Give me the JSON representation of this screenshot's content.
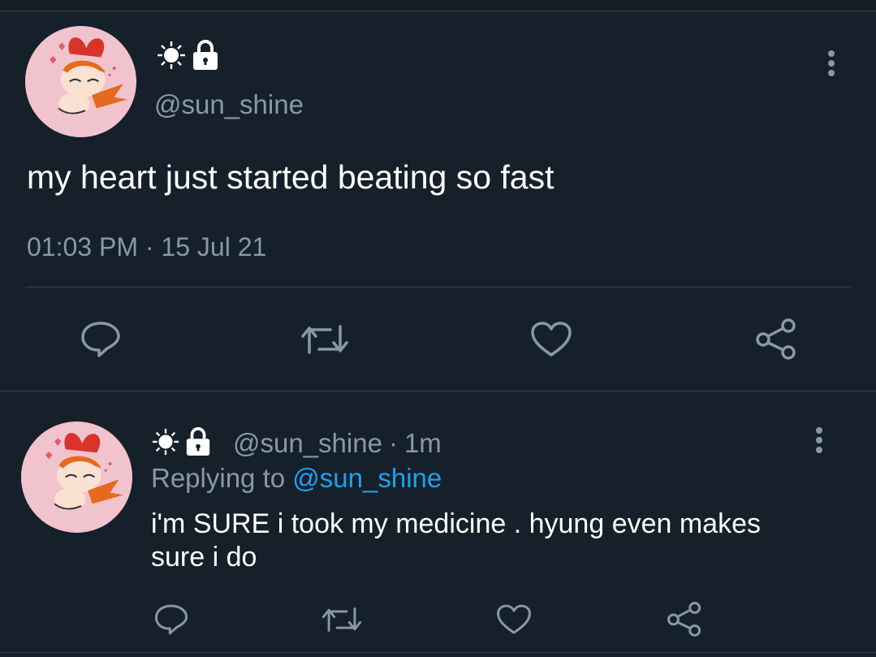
{
  "main_tweet": {
    "handle": "@sun_shine",
    "text": "my heart just started beating so fast",
    "time": "01:03 PM",
    "date_sep": "·",
    "date": "15 Jul 21"
  },
  "reply_tweet": {
    "handle": "@sun_shine",
    "sep": "·",
    "age": "1m",
    "replying_prefix": "Replying to",
    "replying_to": "@sun_shine",
    "text": "i'm SURE i took my medicine . hyung even makes sure i do"
  },
  "icons": {
    "avatar": "powerpuff-avatar-icon",
    "sun": "sun-icon",
    "lock": "lock-icon",
    "more": "more-vertical-icon",
    "reply": "reply-icon",
    "retweet": "retweet-icon",
    "like": "heart-icon",
    "share": "share-icon"
  },
  "colors": {
    "background": "#15202b",
    "muted_text": "#8899a6",
    "link": "#1da1f2",
    "divider": "#38444d",
    "avatar_bg": "#f1c3cd"
  }
}
